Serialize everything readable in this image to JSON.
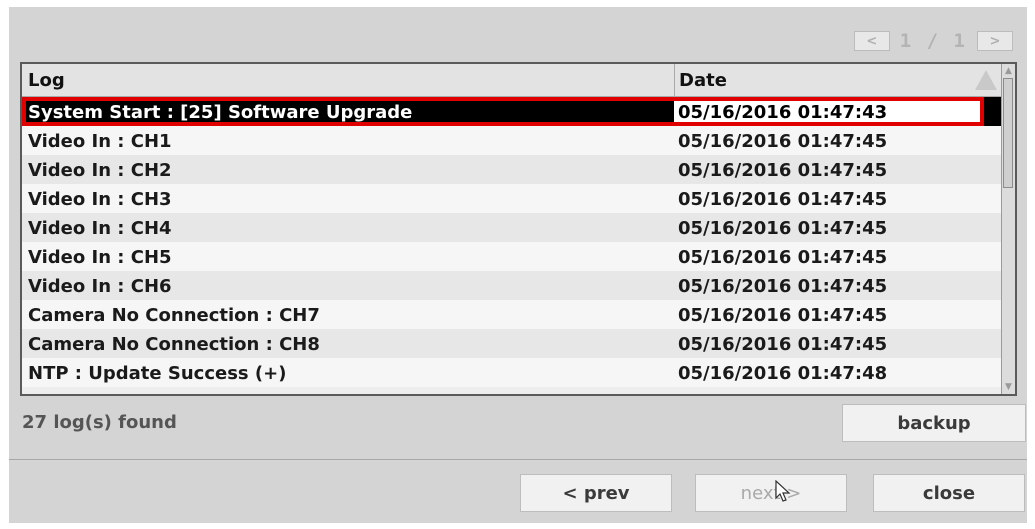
{
  "pager": {
    "prev_icon": "<",
    "text": "1 / 1",
    "next_icon": ">"
  },
  "table": {
    "headers": {
      "log": "Log",
      "date": "Date"
    },
    "rows": [
      {
        "log": "System Start : [25] Software Upgrade",
        "date": "05/16/2016 01:47:43"
      },
      {
        "log": "Video In : CH1",
        "date": "05/16/2016 01:47:45"
      },
      {
        "log": "Video In : CH2",
        "date": "05/16/2016 01:47:45"
      },
      {
        "log": "Video In : CH3",
        "date": "05/16/2016 01:47:45"
      },
      {
        "log": "Video In : CH4",
        "date": "05/16/2016 01:47:45"
      },
      {
        "log": "Video In : CH5",
        "date": "05/16/2016 01:47:45"
      },
      {
        "log": "Video In : CH6",
        "date": "05/16/2016 01:47:45"
      },
      {
        "log": "Camera No Connection : CH7",
        "date": "05/16/2016 01:47:45"
      },
      {
        "log": "Camera No Connection : CH8",
        "date": "05/16/2016 01:47:45"
      },
      {
        "log": "NTP : Update Success (+)",
        "date": "05/16/2016 01:47:48"
      }
    ]
  },
  "status": "27 log(s) found",
  "buttons": {
    "backup": "backup",
    "prev": "< prev",
    "next": "next >",
    "close": "close"
  },
  "colors": {
    "highlight": "#e10000",
    "selected_bg": "#000000",
    "panel_bg": "#d4d4d4"
  }
}
